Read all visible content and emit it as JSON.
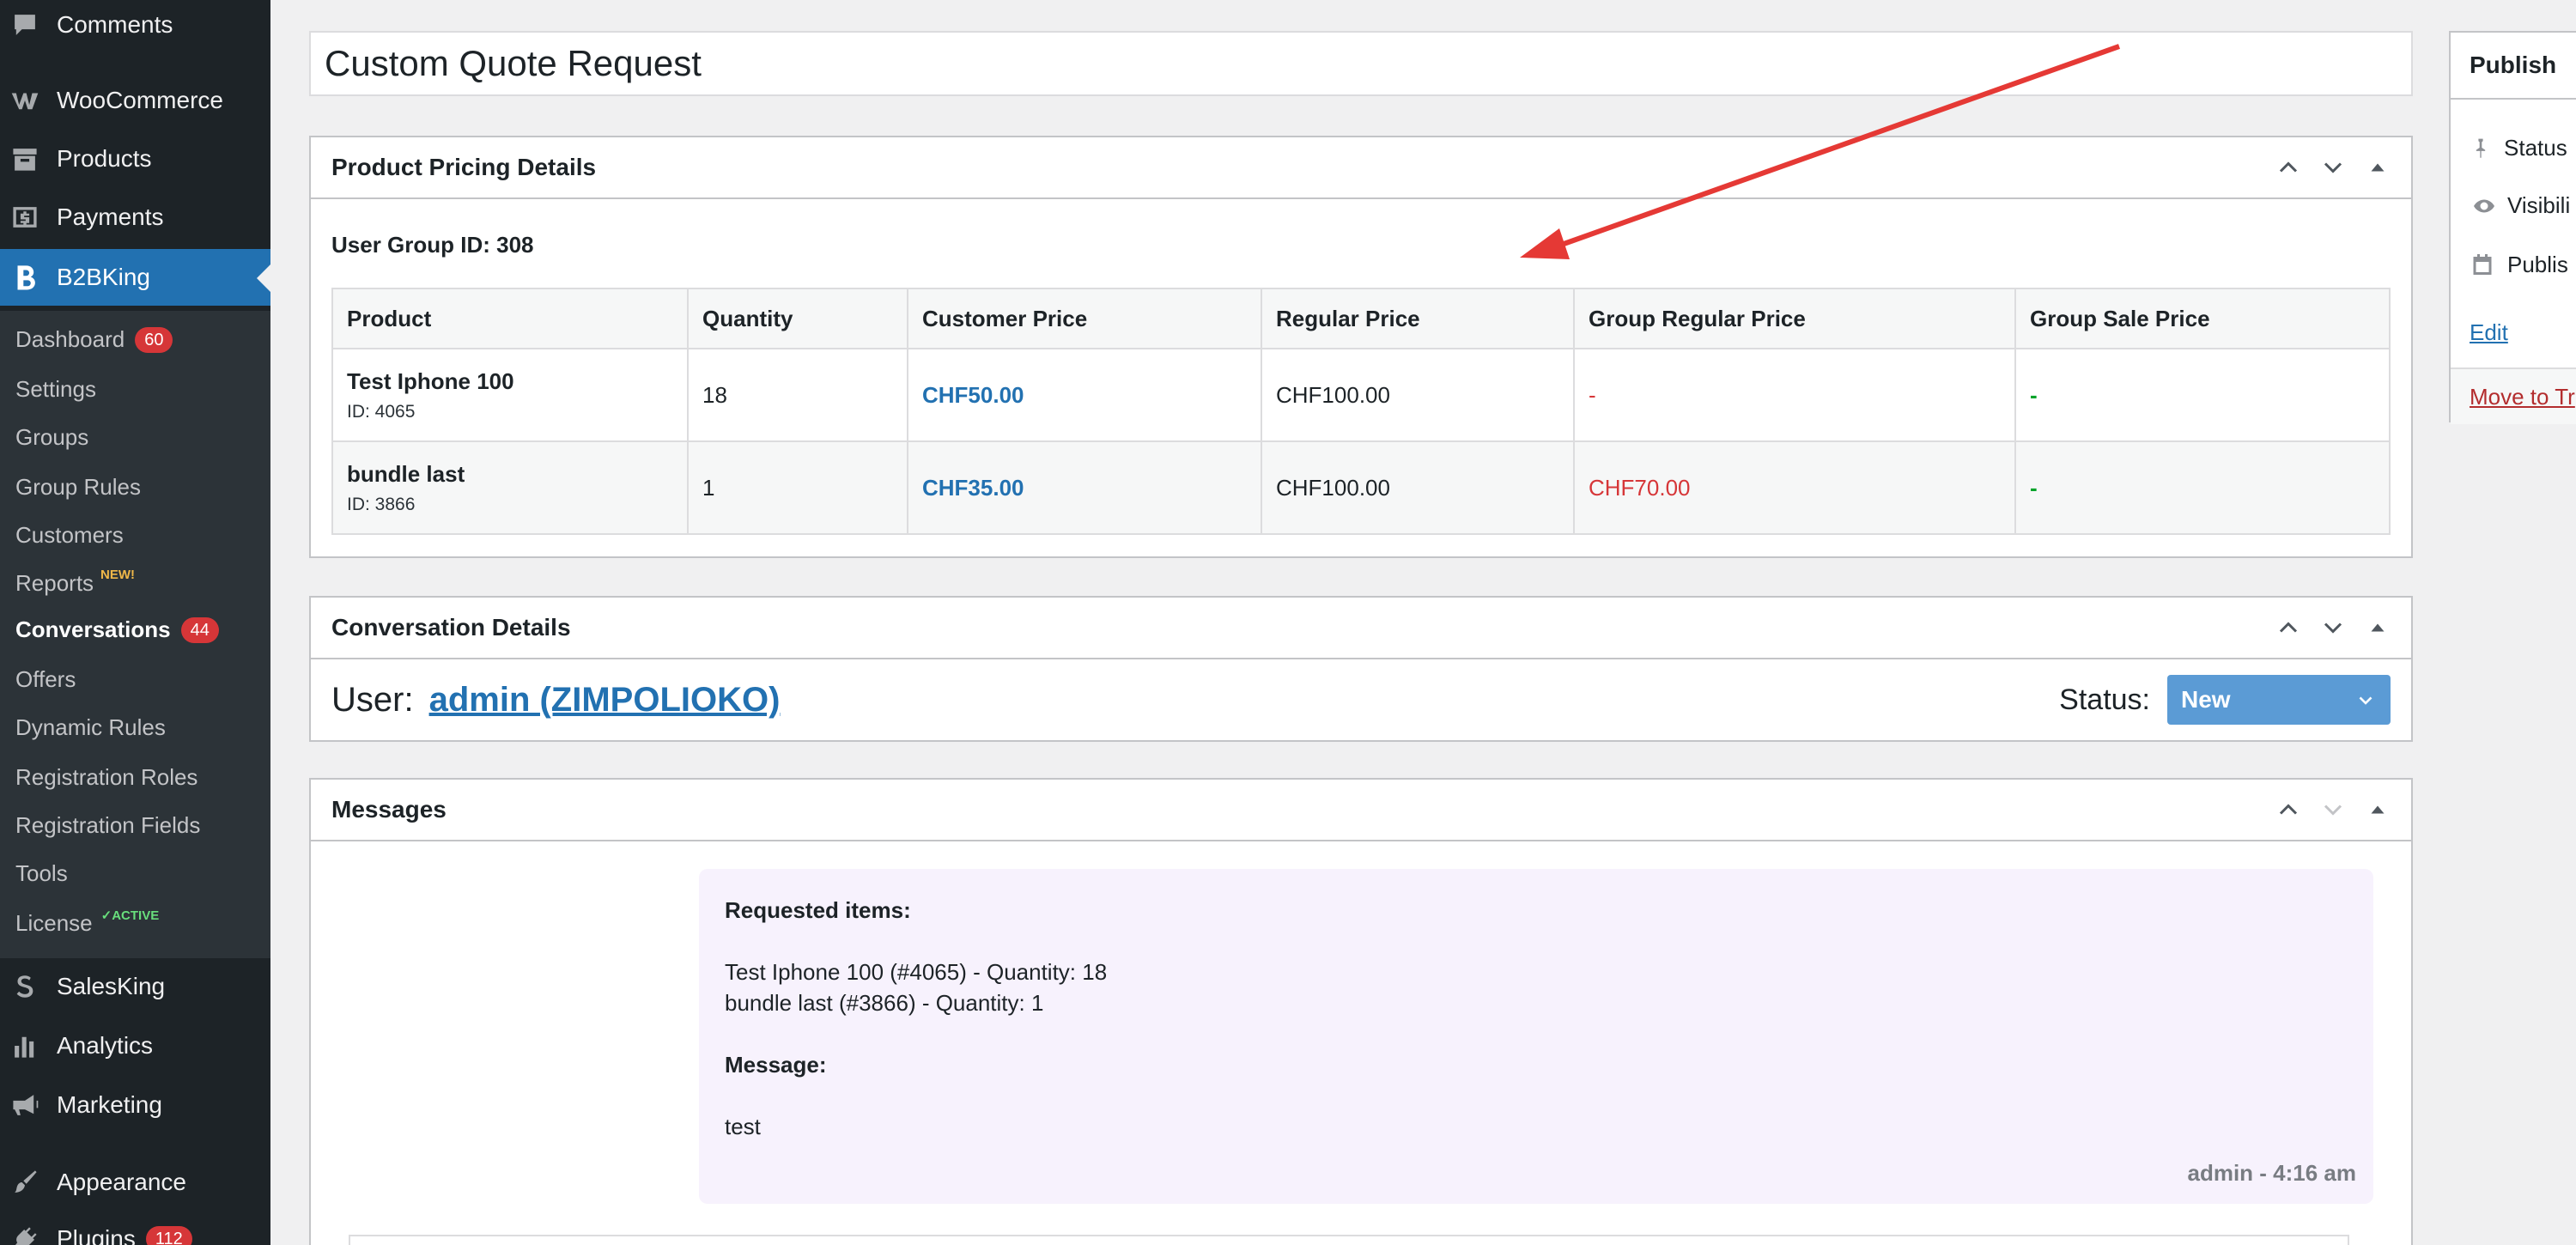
{
  "sidebar": {
    "comments": "Comments",
    "woocommerce": "WooCommerce",
    "products": "Products",
    "payments": "Payments",
    "b2bking": "B2BKing",
    "sub": {
      "dashboard": "Dashboard",
      "dashboard_count": "60",
      "settings": "Settings",
      "groups": "Groups",
      "group_rules": "Group Rules",
      "customers": "Customers",
      "reports": "Reports",
      "reports_badge": "NEW!",
      "conversations": "Conversations",
      "conversations_count": "44",
      "offers": "Offers",
      "dynamic_rules": "Dynamic Rules",
      "registration_roles": "Registration Roles",
      "registration_fields": "Registration Fields",
      "tools": "Tools",
      "license": "License",
      "license_badge": "✓ACTIVE"
    },
    "salesking": "SalesKing",
    "analytics": "Analytics",
    "marketing": "Marketing",
    "appearance": "Appearance",
    "plugins": "Plugins",
    "plugins_count": "112"
  },
  "title": "Custom Quote Request",
  "pricing": {
    "heading": "Product Pricing Details",
    "user_group": "User Group ID: 308",
    "columns": [
      "Product",
      "Quantity",
      "Customer Price",
      "Regular Price",
      "Group Regular Price",
      "Group Sale Price"
    ],
    "rows": [
      {
        "name": "Test Iphone 100",
        "id": "ID: 4065",
        "qty": "18",
        "customer": "CHF50.00",
        "regular": "CHF100.00",
        "group_regular": "-",
        "group_sale": "-"
      },
      {
        "name": "bundle last",
        "id": "ID: 3866",
        "qty": "1",
        "customer": "CHF35.00",
        "regular": "CHF100.00",
        "group_regular": "CHF70.00",
        "group_sale": "-"
      }
    ]
  },
  "conversation": {
    "heading": "Conversation Details",
    "user_label": "User:",
    "user_link": "admin (ZIMPOLIOKO)",
    "status_label": "Status:",
    "status_value": "New"
  },
  "messages": {
    "heading": "Messages",
    "requested_label": "Requested items:",
    "line1": "Test Iphone 100 (#4065) - Quantity: 18",
    "line2": "bundle last (#3866) - Quantity: 1",
    "message_label": "Message:",
    "message_text": "test",
    "meta": "admin - 4:16 am"
  },
  "publish": {
    "heading": "Publish",
    "status": "Status",
    "visibility": "Visibili",
    "published": "Publis",
    "edit": "Edit",
    "trash": "Move to Tr"
  },
  "colors": {
    "accent": "#2271b1",
    "sidebar": "#1d2327",
    "badge": "#d63638",
    "arrow": "#e53935"
  }
}
